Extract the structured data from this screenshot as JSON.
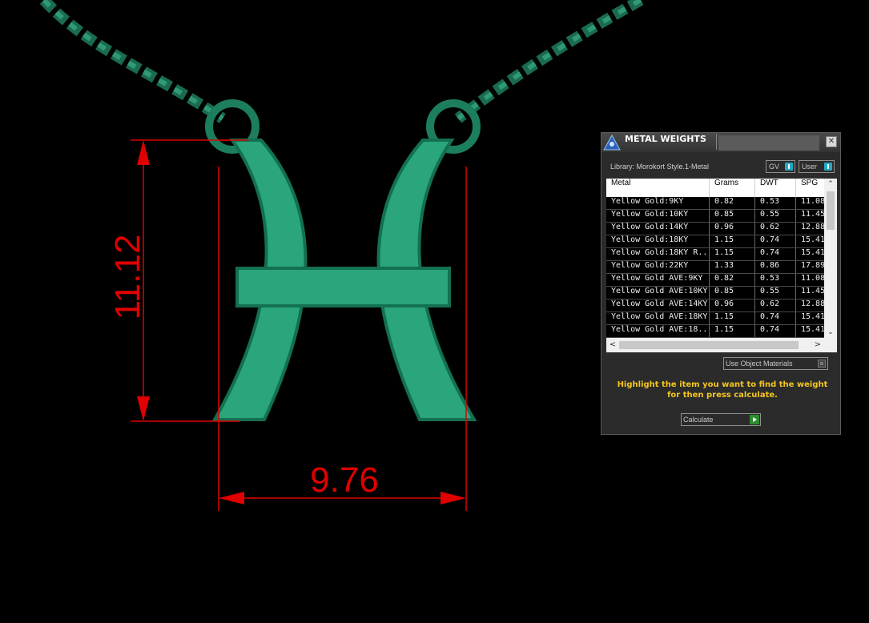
{
  "dimensions": {
    "height_label": "11.12",
    "width_label": "9.76",
    "dimension_color": "#e00000"
  },
  "model": {
    "pendant_color": "#2aa57c",
    "chain_color": "#1f7a5c"
  },
  "panel": {
    "title": "METAL WEIGHTS",
    "close_icon": "close-icon",
    "library_label": "Library: Morokort Style.1-Metal",
    "toggle_gv": "GV",
    "toggle_user": "User",
    "columns": [
      "Metal",
      "Grams",
      "DWT",
      "SPG"
    ],
    "rows": [
      [
        "Yellow Gold:9KY",
        "0.82",
        "0.53",
        "11.08"
      ],
      [
        "Yellow Gold:10KY",
        "0.85",
        "0.55",
        "11.45"
      ],
      [
        "Yellow Gold:14KY",
        "0.96",
        "0.62",
        "12.88"
      ],
      [
        "Yellow Gold:18KY",
        "1.15",
        "0.74",
        "15.41"
      ],
      [
        "Yellow Gold:18KY R...",
        "1.15",
        "0.74",
        "15.41"
      ],
      [
        "Yellow Gold:22KY",
        "1.33",
        "0.86",
        "17.89"
      ],
      [
        "Yellow Gold AVE:9KY",
        "0.82",
        "0.53",
        "11.08"
      ],
      [
        "Yellow Gold AVE:10KY",
        "0.85",
        "0.55",
        "11.45"
      ],
      [
        "Yellow Gold AVE:14KY",
        "0.96",
        "0.62",
        "12.88"
      ],
      [
        "Yellow Gold AVE:18KY",
        "1.15",
        "0.74",
        "15.41"
      ],
      [
        "Yellow Gold AVE:18...",
        "1.15",
        "0.74",
        "15.41"
      ]
    ],
    "use_object_materials": "Use Object Materials",
    "hint": "Highlight the item you want to find the weight for then press calculate.",
    "calculate_label": "Calculate",
    "accent_color": "#f3c620"
  }
}
